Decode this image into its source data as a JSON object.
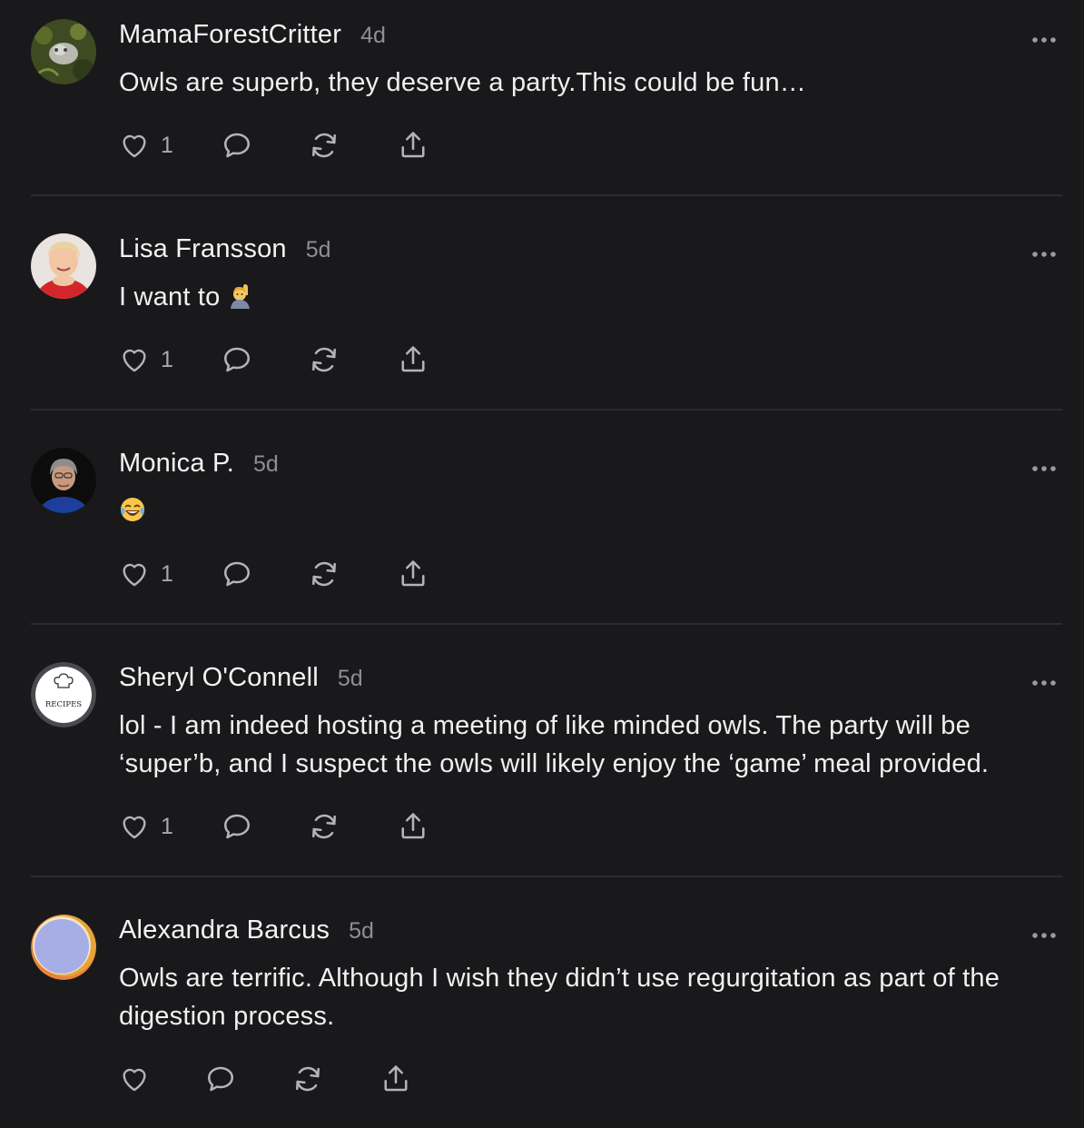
{
  "comments": [
    {
      "author": "MamaForestCritter",
      "age": "4d",
      "text": "Owls are superb, they deserve a party.This could be fun…",
      "likes": "1",
      "avatar_icon": "owl-figurine-avatar"
    },
    {
      "author": "Lisa Fransson",
      "age": "5d",
      "text": "I want to",
      "emoji": "raising-hand-emoji",
      "likes": "1",
      "avatar_icon": "woman-red-top-avatar"
    },
    {
      "author": "Monica P.",
      "age": "5d",
      "text": "",
      "emoji": "tears-of-joy-emoji",
      "likes": "1",
      "avatar_icon": "woman-portrait-avatar"
    },
    {
      "author": "Sheryl O'Connell",
      "age": "5d",
      "text": "lol - I am indeed hosting a meeting of like minded owls. The party will be ‘super’b, and I suspect the owls will likely enjoy the ‘game’ meal provided.",
      "likes": "1",
      "avatar_icon": "recipes-logo-avatar",
      "avatar_text": "RECIPES"
    },
    {
      "author": "Alexandra Barcus",
      "age": "5d",
      "text": "Owls are terrific. Although I wish they didn’t use regurgitation as part of the digestion process.",
      "likes": "",
      "avatar_icon": "abstract-circle-avatar"
    }
  ],
  "colors": {
    "background": "#19191b",
    "divider": "#2c2c2e",
    "secondary_text": "#8e8e93",
    "icon": "#b4b4b8"
  }
}
